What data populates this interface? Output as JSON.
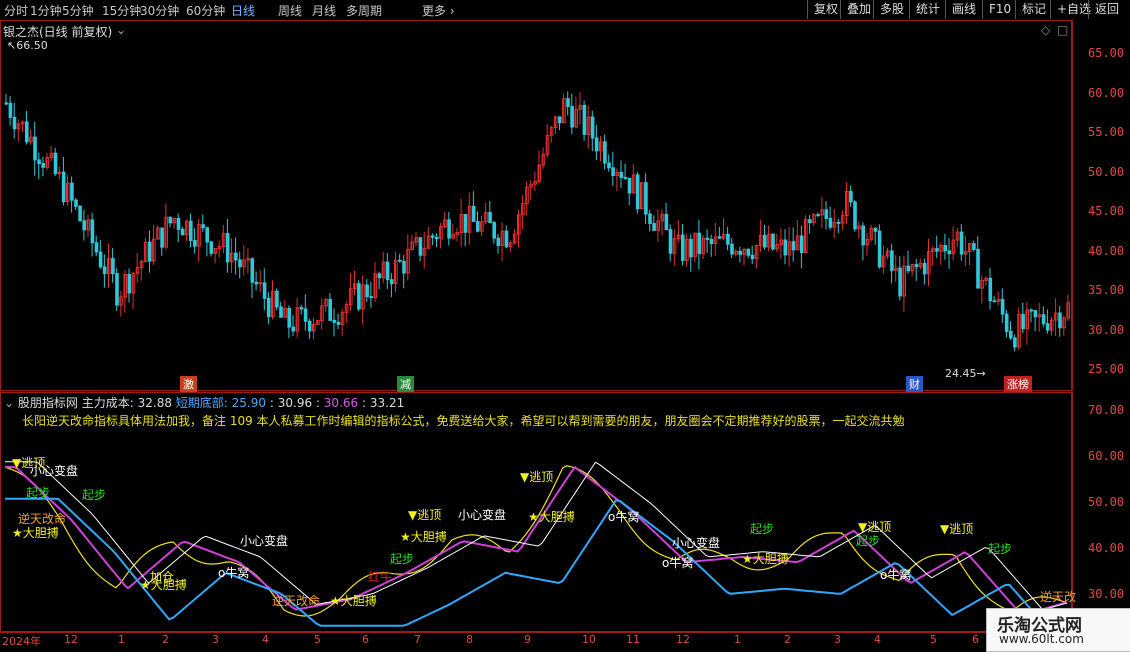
{
  "toolbar": {
    "periods": [
      "分时",
      "1分钟",
      "5分钟",
      "15分钟",
      "30分钟",
      "60分钟",
      "日线",
      "周线",
      "月线",
      "多周期",
      "更多"
    ],
    "active_period": "日线",
    "buttons": [
      "复权",
      "叠加",
      "多股",
      "统计",
      "画线",
      "F10",
      "标记",
      "+自选",
      "返回"
    ]
  },
  "kline": {
    "title": "银之杰(日线 前复权)",
    "high_marker": "66.50",
    "low_marker": "24.45",
    "y_ticks": [
      "65.00",
      "60.00",
      "55.00",
      "50.00",
      "45.00",
      "40.00",
      "35.00",
      "30.00",
      "25.00"
    ],
    "event_tags": [
      {
        "label": "激",
        "color": "#c84020"
      },
      {
        "label": "减",
        "color": "#2a8a3a"
      },
      {
        "label": "财",
        "color": "#2a58c0"
      },
      {
        "label": "涨榜",
        "color": "#c02020"
      }
    ]
  },
  "indicator": {
    "name": "股朋指标网",
    "main_cost_label": "主力成本:",
    "main_cost_value": "32.88",
    "short_bottom_label": "短期底部:",
    "short_bottom_value": "25.90",
    "v3": "30.96",
    "v4": "30.66",
    "v5": "33.21",
    "note": "长阳逆天改命指标具体用法加我，备注 109 本人私募工作时编辑的指标公式，免费送给大家，希望可以帮到需要的朋友，朋友圈会不定期推荐好的股票，一起交流共勉",
    "y_ticks": [
      "70.00",
      "60.00",
      "50.00",
      "40.00",
      "30.00"
    ],
    "annotations": [
      "▼逃顶",
      "小心变盘",
      "起步",
      "起步",
      "★大胆搏",
      "★大胆搏",
      "逆天改命",
      "★大胆搏",
      "加仓",
      "小心变盘",
      "o牛窝",
      "逆天改命",
      "★大胆搏",
      "▼逃顶",
      "小心变盘",
      "▼逃顶",
      "★大胆搏",
      "o牛窝",
      "小心变盘",
      "起步",
      "★大胆搏",
      "o牛窝",
      "▼逃顶",
      "起步",
      "o牛窝",
      "▼逃顶",
      "起步",
      "逆天改",
      "红牛",
      "起步"
    ]
  },
  "dates": [
    "2024年",
    "12",
    "1",
    "2",
    "3",
    "4",
    "5",
    "6",
    "7",
    "8",
    "9",
    "10",
    "11",
    "12",
    "1",
    "2",
    "3",
    "4",
    "5",
    "6"
  ],
  "watermark": {
    "title": "乐淘公式网",
    "url": "www.60lt.com"
  },
  "chart_data": {
    "type": "candlestick",
    "title": "银之杰(日线 前复权)",
    "ylim": [
      23,
      68
    ],
    "x": [
      "2024年",
      "12",
      "1",
      "2",
      "3",
      "4",
      "5",
      "6",
      "7",
      "8",
      "9",
      "10",
      "11",
      "12",
      "1",
      "2",
      "3",
      "4",
      "5",
      "6"
    ],
    "close_approx": [
      58,
      48,
      35,
      44,
      40,
      31,
      33,
      38,
      44,
      42,
      58,
      50,
      40,
      41,
      40,
      46,
      36,
      42,
      30,
      33
    ],
    "high": 66.5,
    "low": 24.45,
    "indicator_ylim": [
      27,
      72
    ]
  }
}
